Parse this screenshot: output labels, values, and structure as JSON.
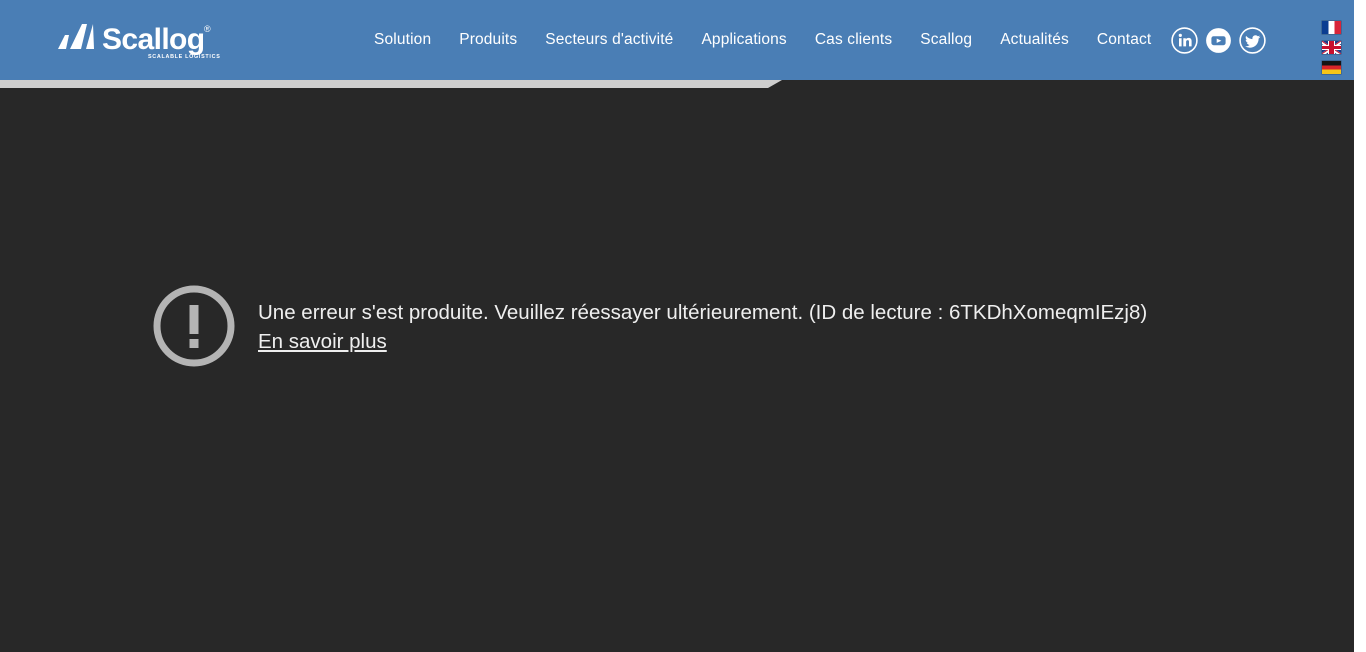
{
  "header": {
    "logo": {
      "name": "Scallog",
      "wordmark": "Scallog",
      "registered_mark": "®",
      "tagline": "SCALABLE LOGISTICS"
    },
    "background_color": "#4a7eb5",
    "nav_items": [
      {
        "label": "Solution",
        "name": "nav-item-solution"
      },
      {
        "label": "Produits",
        "name": "nav-item-produits"
      },
      {
        "label": "Secteurs d'activité",
        "name": "nav-item-secteurs-activite"
      },
      {
        "label": "Applications",
        "name": "nav-item-applications"
      },
      {
        "label": "Cas clients",
        "name": "nav-item-cas-clients"
      },
      {
        "label": "Scallog",
        "name": "nav-item-scallog"
      },
      {
        "label": "Actualités",
        "name": "nav-item-actualites"
      },
      {
        "label": "Contact",
        "name": "nav-item-contact"
      }
    ],
    "social_links": [
      {
        "icon": "linkedin-icon",
        "label": "LinkedIn"
      },
      {
        "icon": "youtube-icon",
        "label": "YouTube"
      },
      {
        "icon": "twitter-icon",
        "label": "Twitter"
      }
    ],
    "language_flags": [
      {
        "icon": "flag-fr-icon",
        "label": "Français"
      },
      {
        "icon": "flag-gb-icon",
        "label": "English"
      },
      {
        "icon": "flag-de-icon",
        "label": "Deutsch"
      }
    ]
  },
  "loading_bar": {
    "name": "page-loading-bar",
    "color": "#cfcfcf",
    "progress_percent": 58
  },
  "video_error": {
    "icon": "error-exclamation-icon",
    "message": "Une erreur s'est produite. Veuillez réessayer ultérieurement. (ID de lecture : 6TKDhXomeqmIEzj8)",
    "playback_id": "6TKDhXomeqmIEzj8",
    "link_label": "En savoir plus",
    "text_color": "#efefef",
    "background_color": "#282828"
  }
}
